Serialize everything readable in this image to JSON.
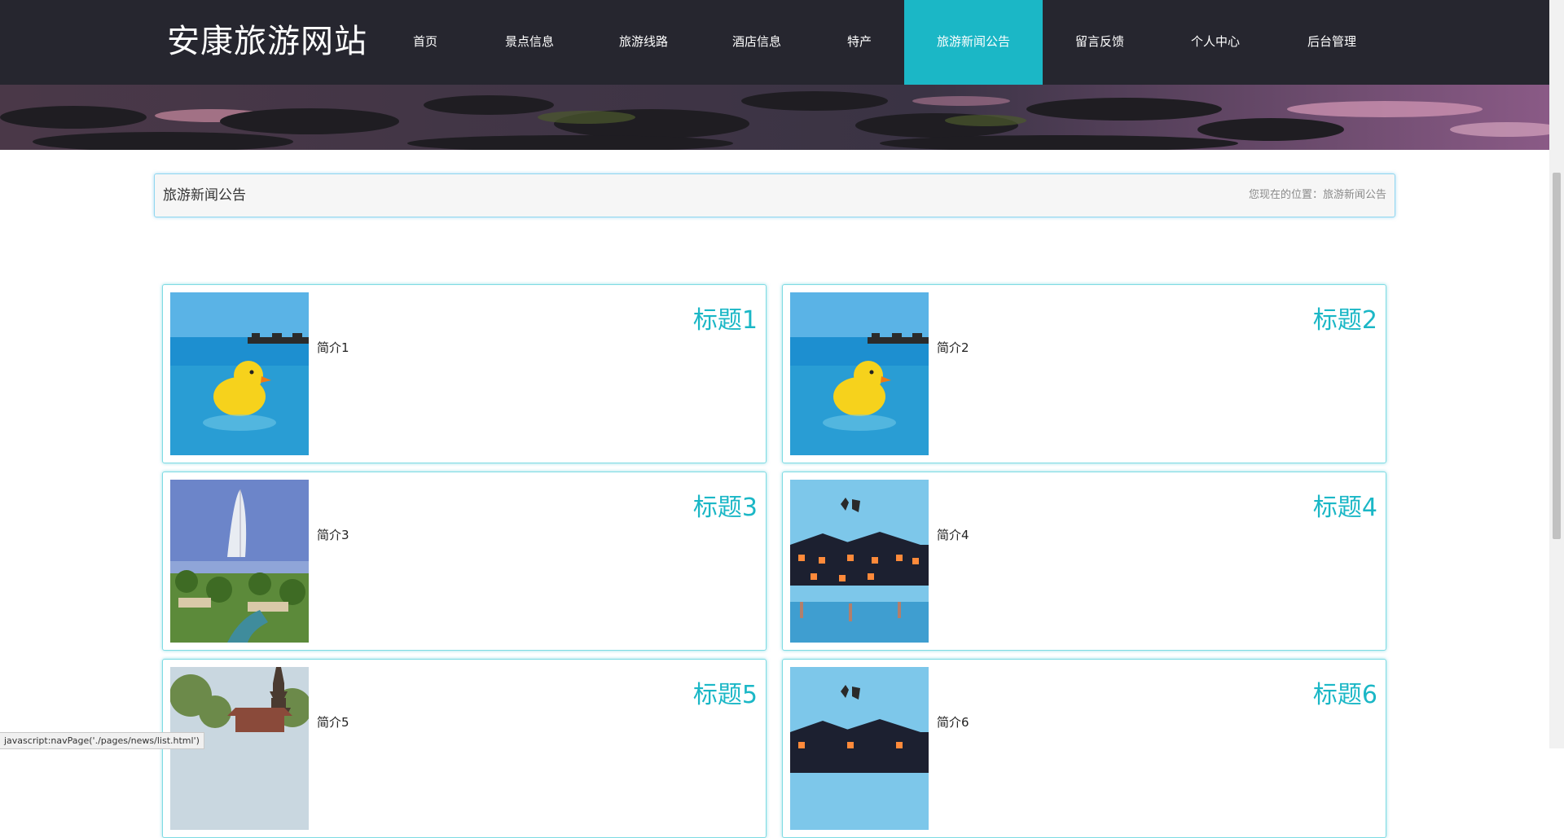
{
  "site": {
    "logo": "安康旅游网站"
  },
  "nav": {
    "items": [
      {
        "label": "首页"
      },
      {
        "label": "景点信息"
      },
      {
        "label": "旅游线路"
      },
      {
        "label": "酒店信息"
      },
      {
        "label": "特产"
      },
      {
        "label": "旅游新闻公告"
      },
      {
        "label": "留言反馈"
      },
      {
        "label": "个人中心"
      },
      {
        "label": "后台管理"
      }
    ],
    "active_index": 5
  },
  "page": {
    "title": "旅游新闻公告",
    "breadcrumb": "您现在的位置：旅游新闻公告"
  },
  "news": [
    {
      "title": "标题1",
      "summary": "简介1",
      "image": "rubber-duck-pool"
    },
    {
      "title": "标题2",
      "summary": "简介2",
      "image": "rubber-duck-pool"
    },
    {
      "title": "标题3",
      "summary": "简介3",
      "image": "burj-al-arab"
    },
    {
      "title": "标题4",
      "summary": "简介4",
      "image": "xitang-water-town"
    },
    {
      "title": "标题5",
      "summary": "简介5",
      "image": "pagoda"
    },
    {
      "title": "标题6",
      "summary": "简介6",
      "image": "xitang-water-town"
    }
  ],
  "status_bar": {
    "text": "javascript:navPage('./pages/news/list.html')"
  },
  "colors": {
    "header_bg": "#26262f",
    "accent": "#1bb7c6",
    "card_border": "#7edbe3"
  }
}
